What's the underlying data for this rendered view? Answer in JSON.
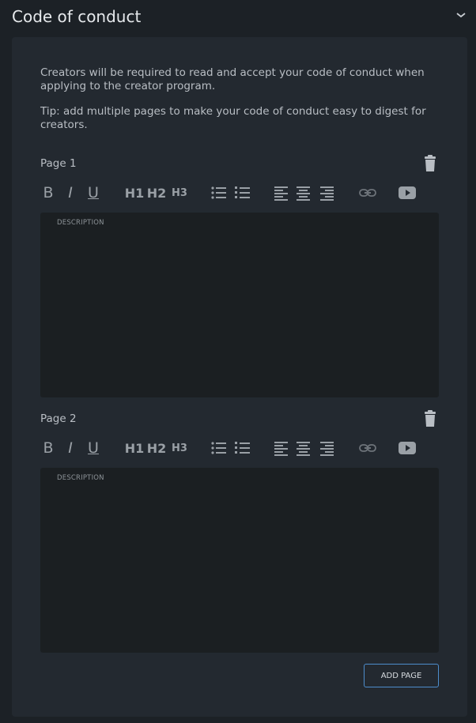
{
  "section": {
    "title": "Code of conduct",
    "collapse_icon": "chevron-down-icon"
  },
  "intro": {
    "line1": "Creators will be required to read and accept your code of conduct when applying to the creator program.",
    "line2": "Tip: add multiple pages to make your code of conduct easy to digest for creators."
  },
  "toolbar": {
    "bold": "B",
    "italic": "I",
    "underline": "U",
    "h1": "H1",
    "h2": "H2",
    "h3": "H3",
    "icons": [
      "bold-icon",
      "italic-icon",
      "underline-icon",
      "h1-icon",
      "h2-icon",
      "h3-icon",
      "bullet-list-icon",
      "numbered-list-icon",
      "align-left-icon",
      "align-center-icon",
      "align-right-icon",
      "link-icon",
      "youtube-icon"
    ]
  },
  "pages": [
    {
      "label": "Page 1",
      "placeholder": "DESCRIPTION"
    },
    {
      "label": "Page 2",
      "placeholder": "DESCRIPTION"
    }
  ],
  "add_page_label": "ADD PAGE",
  "colors": {
    "background": "#1c2126",
    "card": "#232930",
    "editor": "#1b1f22",
    "accent_border": "#4d8dcc",
    "icon": "#9aa0a6"
  }
}
